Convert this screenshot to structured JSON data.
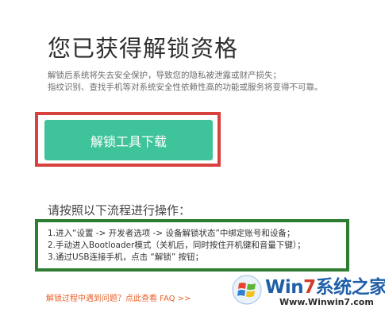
{
  "title": "您已获得解锁资格",
  "warning": {
    "line1": "解锁后系统将失去安全保护，导致您的隐私被泄露或财产损失；",
    "line2": "指纹识别、查找手机等对系统安全性依赖性高的功能或服务将变得不可靠。"
  },
  "download_button": {
    "label": "解锁工具下载"
  },
  "steps_title": "请按照以下流程进行操作：",
  "steps": [
    "1.进入“设置 -> 开发者选项 -> 设备解锁状态”中绑定账号和设备；",
    "2.手动进入Bootloader模式（关机后，同时按住开机键和音量下键）；",
    "3.通过USB连接手机，点击 “解锁” 按钮；"
  ],
  "help_link": "解锁过程中遇到问题？点此查看 FAQ >>",
  "watermark": {
    "logo_prefix": "Win",
    "logo_seven": "7",
    "logo_suffix": "系统之家",
    "url": "Www.Winwin7.com"
  },
  "colors": {
    "button": "#3fc39a",
    "button_highlight": "#d7423f",
    "steps_highlight": "#2e7d32",
    "link": "#e8632b"
  }
}
